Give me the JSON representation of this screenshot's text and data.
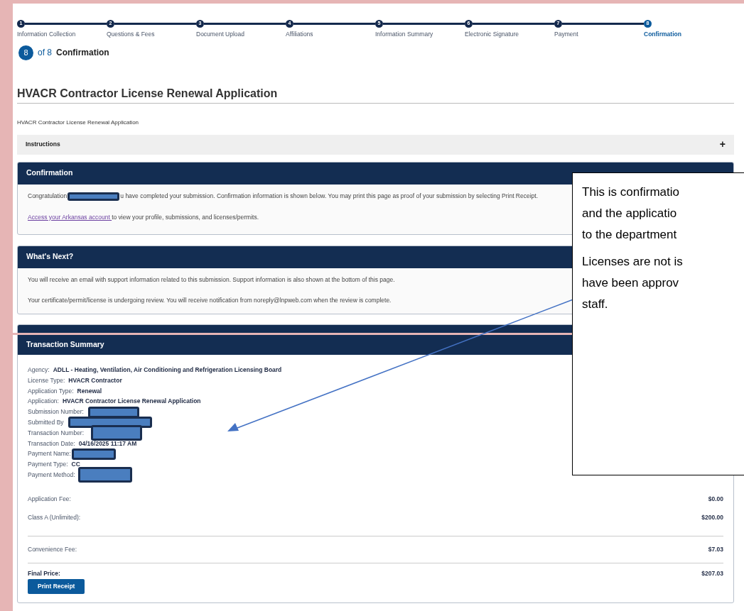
{
  "stepper": {
    "steps": [
      {
        "number": "1",
        "label": "Information Collection",
        "selected": false
      },
      {
        "number": "2",
        "label": "Questions & Fees",
        "selected": false
      },
      {
        "number": "3",
        "label": "Document Upload",
        "selected": false
      },
      {
        "number": "4",
        "label": "Affiliations",
        "selected": false
      },
      {
        "number": "5",
        "label": "Information Summary",
        "selected": false
      },
      {
        "number": "6",
        "label": "Electronic Signature",
        "selected": false
      },
      {
        "number": "7",
        "label": "Payment",
        "selected": false
      },
      {
        "number": "8",
        "label": "Confirmation",
        "selected": true
      }
    ],
    "progress": {
      "current": "8",
      "of": "of 8",
      "label": "Confirmation"
    }
  },
  "page_title": "HVACR Contractor License Renewal Application",
  "subtitle": "HVACR Contractor License Renewal Application",
  "instructions": {
    "label": "Instructions",
    "toggle": "+",
    "expanded": false
  },
  "confirmation": {
    "title": "Confirmation",
    "before_redaction": "Congratulation",
    "after_redaction": "u have completed your submission. Confirmation information is shown below. You may print this page as proof of your submission by selecting Print Receipt.",
    "link": "Access your Arkansas account ",
    "link_rest": "to view your profile, submissions, and licenses/permits."
  },
  "whats_next": {
    "title": "What's Next?",
    "paragraphs": [
      "You will receive an email with support information related to this submission. Support information is also shown at the bottom of this page.",
      "Your certificate/permit/license is undergoing review. You will receive notification from noreply@lnpweb.com when the review is complete."
    ]
  },
  "transaction_summary": {
    "title": "Transaction Summary",
    "details": [
      {
        "label": "Agency:",
        "value": "ADLL - Heating, Ventilation, Air Conditioning and Refrigeration Licensing Board",
        "redacted": false
      },
      {
        "label": "License Type:",
        "value": "HVACR Contractor",
        "redacted": false
      },
      {
        "label": "Application Type:",
        "value": "Renewal",
        "redacted": false
      },
      {
        "label": "Application:",
        "value": "HVACR Contractor License Renewal Application",
        "redacted": false
      },
      {
        "label": "Submission Number:",
        "redacted": true
      },
      {
        "label": "Submitted By",
        "redacted": true
      },
      {
        "label": "Transaction Number:",
        "redacted": true
      },
      {
        "label": "Transaction Date:",
        "value": "04/16/2025 11:17 AM",
        "redacted": false
      },
      {
        "label": "Payment Name:",
        "redacted": true
      },
      {
        "label": "Payment Type:",
        "value": "CC",
        "redacted": false
      },
      {
        "label": "Payment Method:",
        "redacted": true
      }
    ],
    "fees": [
      {
        "label": "Application Fee:",
        "amount": "$0.00"
      },
      {
        "label": "Class A (Unlimited):",
        "amount": "$200.00"
      }
    ],
    "convenience_fee": {
      "label": "Convenience Fee:",
      "amount": "$7.03"
    },
    "final_price": {
      "label": "Final Price:",
      "amount": "$207.03"
    },
    "button": "Print Receipt"
  },
  "callout": {
    "paragraphs": [
      [
        "This is confirmatio",
        "and the applicatio",
        "to the department"
      ],
      [
        "Licenses are not is",
        "have been approv",
        "staff."
      ]
    ]
  }
}
